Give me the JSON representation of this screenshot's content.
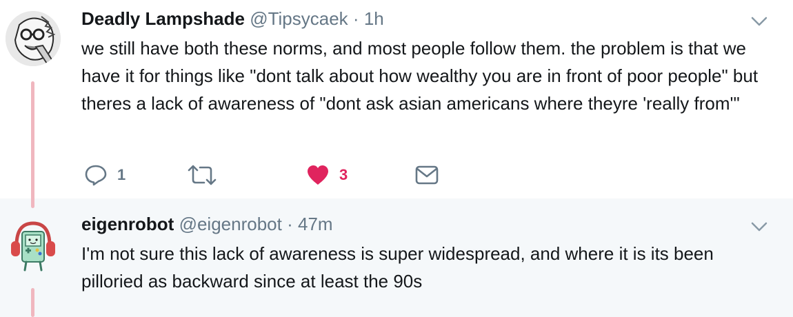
{
  "tweets": [
    {
      "name": "Deadly Lampshade",
      "handle": "@Tipsycaek",
      "separator": "·",
      "time": "1h",
      "text": "we still have both these norms, and most people follow them. the problem is that we have it for things like \"dont talk about how wealthy you are in front of poor people\" but theres a lack of awareness of \"dont ask asian americans where theyre 'really from'\"",
      "reply_count": "1",
      "like_count": "3"
    },
    {
      "name": "eigenrobot",
      "handle": "@eigenrobot",
      "separator": "·",
      "time": "47m",
      "text": "I'm not sure this lack of awareness is super widespread, and where it is its been pilloried as backward since at least the 90s"
    }
  ],
  "colors": {
    "thread_line": "#f0b7bf",
    "like_active": "#e0245e",
    "muted": "#657786",
    "reply_bg": "#f5f8fa"
  }
}
